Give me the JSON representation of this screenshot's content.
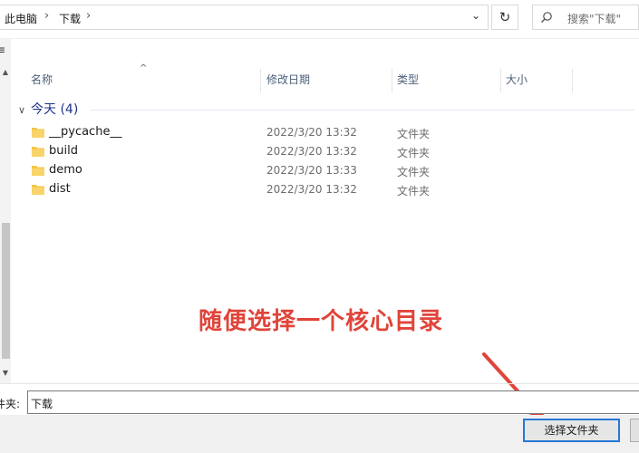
{
  "address_bar": {
    "crumbs": [
      "此电脑",
      "下载"
    ],
    "separator": "›"
  },
  "search": {
    "placeholder": "搜索\"下载\""
  },
  "left_pane": {
    "glyph": "≡"
  },
  "columns": {
    "name": "名称",
    "modified": "修改日期",
    "type": "类型",
    "size": "大小"
  },
  "group": {
    "label": "今天 (4)"
  },
  "files": [
    {
      "name": "__pycache__",
      "modified": "2022/3/20 13:32",
      "type": "文件夹"
    },
    {
      "name": "build",
      "modified": "2022/3/20 13:32",
      "type": "文件夹"
    },
    {
      "name": "demo",
      "modified": "2022/3/20 13:33",
      "type": "文件夹"
    },
    {
      "name": "dist",
      "modified": "2022/3/20 13:32",
      "type": "文件夹"
    }
  ],
  "annotation": {
    "text": "随便选择一个核心目录",
    "color": "#e0443a"
  },
  "folder_field": {
    "label": "件夹:",
    "value": "下载"
  },
  "buttons": {
    "select_folder": "选择文件夹"
  },
  "colors": {
    "accent": "#2677d6",
    "folder": "#f4c542",
    "group_text": "#1e3287"
  }
}
